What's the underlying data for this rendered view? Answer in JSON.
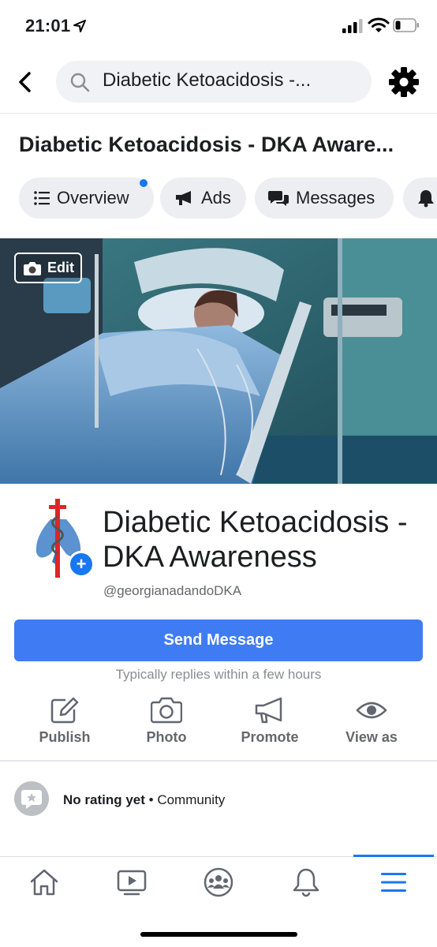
{
  "status_bar": {
    "time": "21:01"
  },
  "search": {
    "query": "Diabetic Ketoacidosis -..."
  },
  "page": {
    "title": "Diabetic Ketoacidosis - DKA Aware...",
    "name": "Diabetic Ketoacidosis - DKA Awareness",
    "username": "@georgianadandoDKA"
  },
  "tabs": [
    {
      "label": "Overview",
      "icon": "list-icon"
    },
    {
      "label": "Ads",
      "icon": "megaphone-icon"
    },
    {
      "label": "Messages",
      "icon": "chat-bubbles-icon"
    },
    {
      "label": "",
      "icon": "bell-icon"
    }
  ],
  "cover": {
    "edit_label": "Edit"
  },
  "cta": {
    "send_message": "Send Message",
    "reply_note": "Typically replies within a few hours"
  },
  "actions": [
    {
      "label": "Publish",
      "icon": "pencil-icon"
    },
    {
      "label": "Photo",
      "icon": "camera-icon"
    },
    {
      "label": "Promote",
      "icon": "megaphone-icon"
    },
    {
      "label": "View as",
      "icon": "eye-icon"
    }
  ],
  "rating": {
    "status": "No rating yet",
    "separator": "•",
    "category": "Community"
  },
  "bottom_nav": [
    {
      "name": "home",
      "icon": "home-icon"
    },
    {
      "name": "watch",
      "icon": "video-icon"
    },
    {
      "name": "groups",
      "icon": "groups-icon"
    },
    {
      "name": "notifications",
      "icon": "bell-icon"
    },
    {
      "name": "menu",
      "icon": "menu-icon",
      "active": true
    }
  ],
  "colors": {
    "accent": "#1877f2",
    "button": "#3f7cf4",
    "muted": "#65676b"
  }
}
